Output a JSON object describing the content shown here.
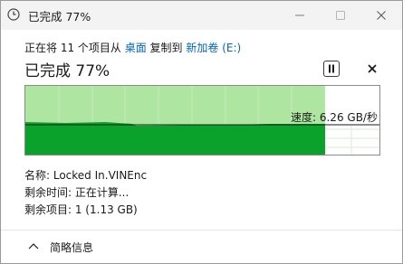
{
  "window": {
    "title": "已完成 77%",
    "icon": "clock-icon"
  },
  "title_controls": {
    "minimize_icon": "minimize-icon",
    "maximize_icon": "maximize-icon",
    "close_icon": "close-icon"
  },
  "copy_status": {
    "prefix": "正在将 11 个项目从 ",
    "source": "桌面",
    "middle": " 复制到 ",
    "destination": "新加卷 (E:)"
  },
  "progress": {
    "title": "已完成 77%",
    "percent": 77,
    "speed_label": "速度: 6.26 GB/秒",
    "pause_icon": "pause-icon",
    "cancel_icon": "close-icon"
  },
  "details": {
    "name": "名称: Locked In.VINEnc",
    "time_remaining": "剩余时间: 正在计算...",
    "items_remaining": "剩余项目: 1 (1.13 GB)"
  },
  "footer": {
    "toggle_label": "简略信息",
    "toggle_icon": "chevron-up-icon"
  },
  "colors": {
    "progress_fill": "#aee5a1",
    "speed_fill": "#0aa22a",
    "grid_line": "#c8ecc0",
    "link": "#0067c0"
  }
}
